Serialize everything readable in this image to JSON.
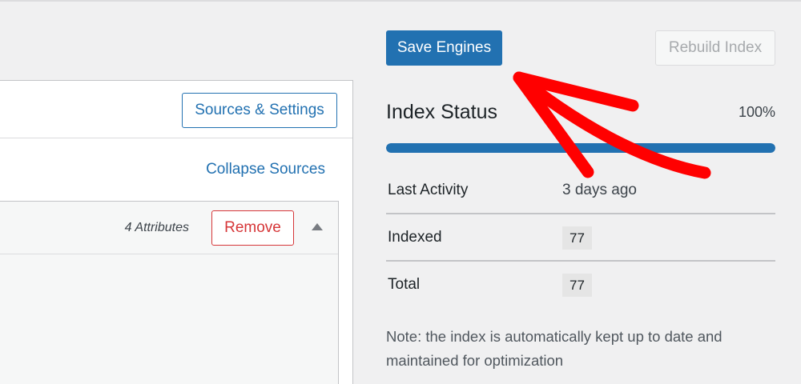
{
  "toolbar": {
    "save_label": "Save Engines",
    "rebuild_label": "Rebuild Index"
  },
  "engine": {
    "sources_settings_label": "Sources & Settings",
    "collapse_label": "Collapse Sources",
    "source": {
      "attributes_text": "4 Attributes",
      "remove_label": "Remove",
      "caret_icon": "caret-up-icon"
    }
  },
  "index_status": {
    "title": "Index Status",
    "percent_text": "100%",
    "progress": 1.0,
    "rows": [
      {
        "label": "Last Activity",
        "value": "3 days ago"
      },
      {
        "label": "Indexed",
        "value": "77"
      },
      {
        "label": "Total",
        "value": "77"
      }
    ],
    "note": "Note: the index is automatically kept up to date and maintained for optimization"
  },
  "annotation": {
    "arrow_color": "#ff0000"
  },
  "colors": {
    "accent": "#2271b1",
    "danger": "#d63638",
    "background": "#f0f0f1"
  }
}
